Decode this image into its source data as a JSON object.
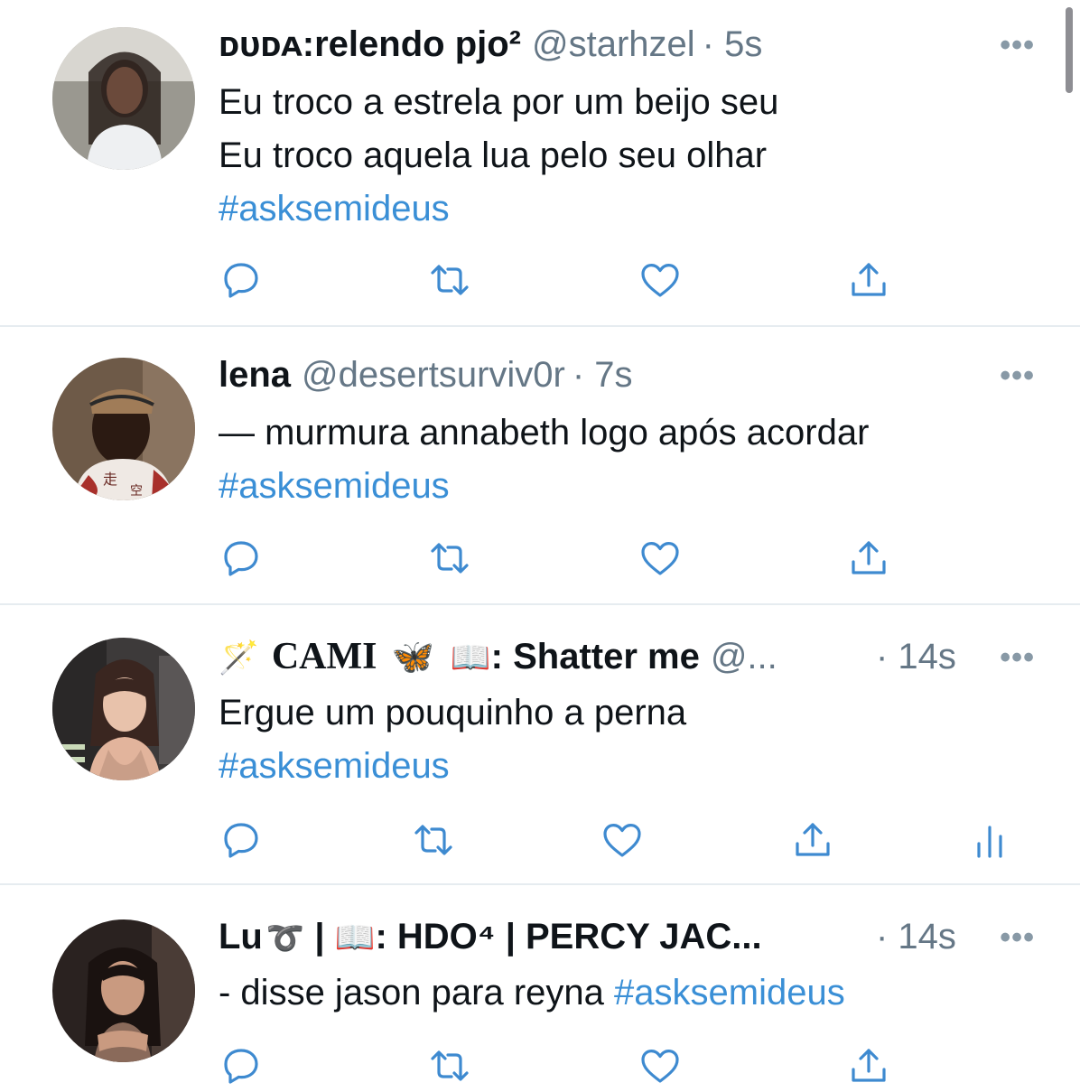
{
  "colors": {
    "hashtag": "#3a8fd6",
    "secondary": "#657786",
    "divider": "#e6ecf0",
    "icon": "#3e8ad0"
  },
  "tweets": [
    {
      "name": "ᴅᴜᴅᴀ:relendo pjo²",
      "handle": "@starhzel",
      "time": "· 5s",
      "lines": [
        "Eu troco a estrela por um beijo seu",
        "Eu troco aquela lua pelo seu olhar"
      ],
      "hashtag": "#asksemideus",
      "more": "•••"
    },
    {
      "name": "lena",
      "handle": "@desertsurviv0r",
      "time": "· 7s",
      "lines": [
        "— murmura annabeth logo após acordar"
      ],
      "hashtag": "#asksemideus",
      "more": "•••"
    },
    {
      "name_wand": "🪄",
      "name_a": "CAMI",
      "name_butterfly": "🦋",
      "name_book": "📖",
      "name_b": ": Shatter me",
      "handle": "@...",
      "time": "· 14s",
      "lines": [
        "Ergue um pouquinho a perna"
      ],
      "hashtag": "#asksemideus",
      "more": "•••"
    },
    {
      "name_a": "Lu",
      "name_sign": "➰",
      "name_b": " | ",
      "name_book": "📖",
      "name_c": ": HDO⁴ | PERCY JAC...",
      "time": "· 14s",
      "line_prefix": "- disse jason para reyna ",
      "hashtag": "#asksemideus",
      "more": "•••"
    }
  ],
  "icons": [
    "reply-icon",
    "retweet-icon",
    "like-icon",
    "share-icon",
    "analytics-icon"
  ]
}
